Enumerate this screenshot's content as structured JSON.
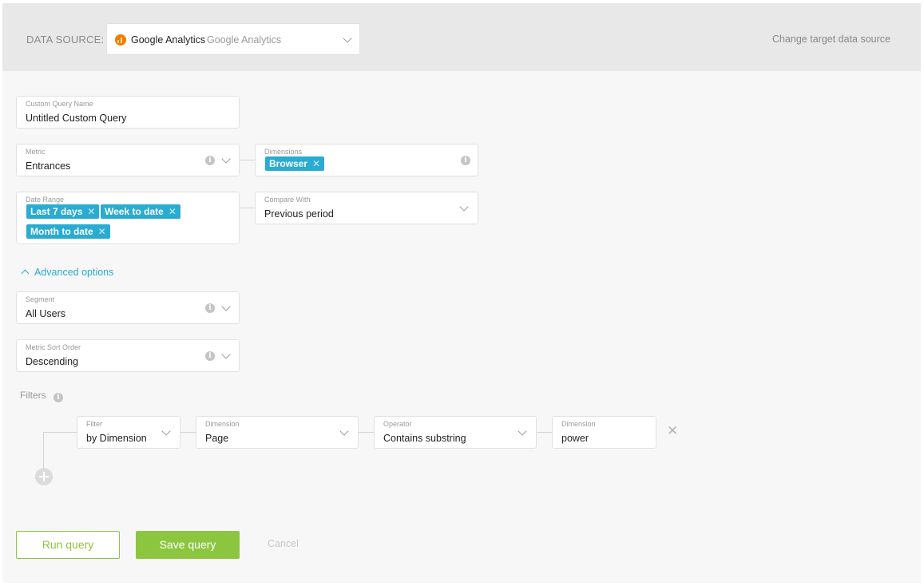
{
  "header": {
    "data_source_label": "DATA SOURCE:",
    "data_source_name": "Google Analytics",
    "data_source_sub": "Google Analytics",
    "change_link": "Change target data source",
    "ga_icon": "google-analytics-icon"
  },
  "form": {
    "query_name": {
      "label": "Custom Query Name",
      "value": "Untitled Custom Query"
    },
    "metric": {
      "label": "Metric",
      "value": "Entrances"
    },
    "dimensions": {
      "label": "Dimensions",
      "chips": [
        "Browser"
      ]
    },
    "date_range": {
      "label": "Date Range",
      "chips": [
        "Last 7 days",
        "Week to date",
        "Month to date"
      ]
    },
    "compare_with": {
      "label": "Compare With",
      "value": "Previous period"
    },
    "advanced_toggle": "Advanced options",
    "segment": {
      "label": "Segment",
      "value": "All Users"
    },
    "sort_order": {
      "label": "Metric Sort Order",
      "value": "Descending"
    },
    "filters_label": "Filters",
    "filter": {
      "type": {
        "label": "Filter",
        "value": "by Dimension"
      },
      "dimension": {
        "label": "Dimension",
        "value": "Page"
      },
      "operator": {
        "label": "Operator",
        "value": "Contains substring"
      },
      "value": {
        "label": "Dimension",
        "value": "power"
      }
    }
  },
  "actions": {
    "run": "Run query",
    "save": "Save query",
    "cancel": "Cancel"
  },
  "colors": {
    "accent": "#2aabd2",
    "primary_green": "#8cc63f",
    "ga_orange": "#f57c00"
  }
}
